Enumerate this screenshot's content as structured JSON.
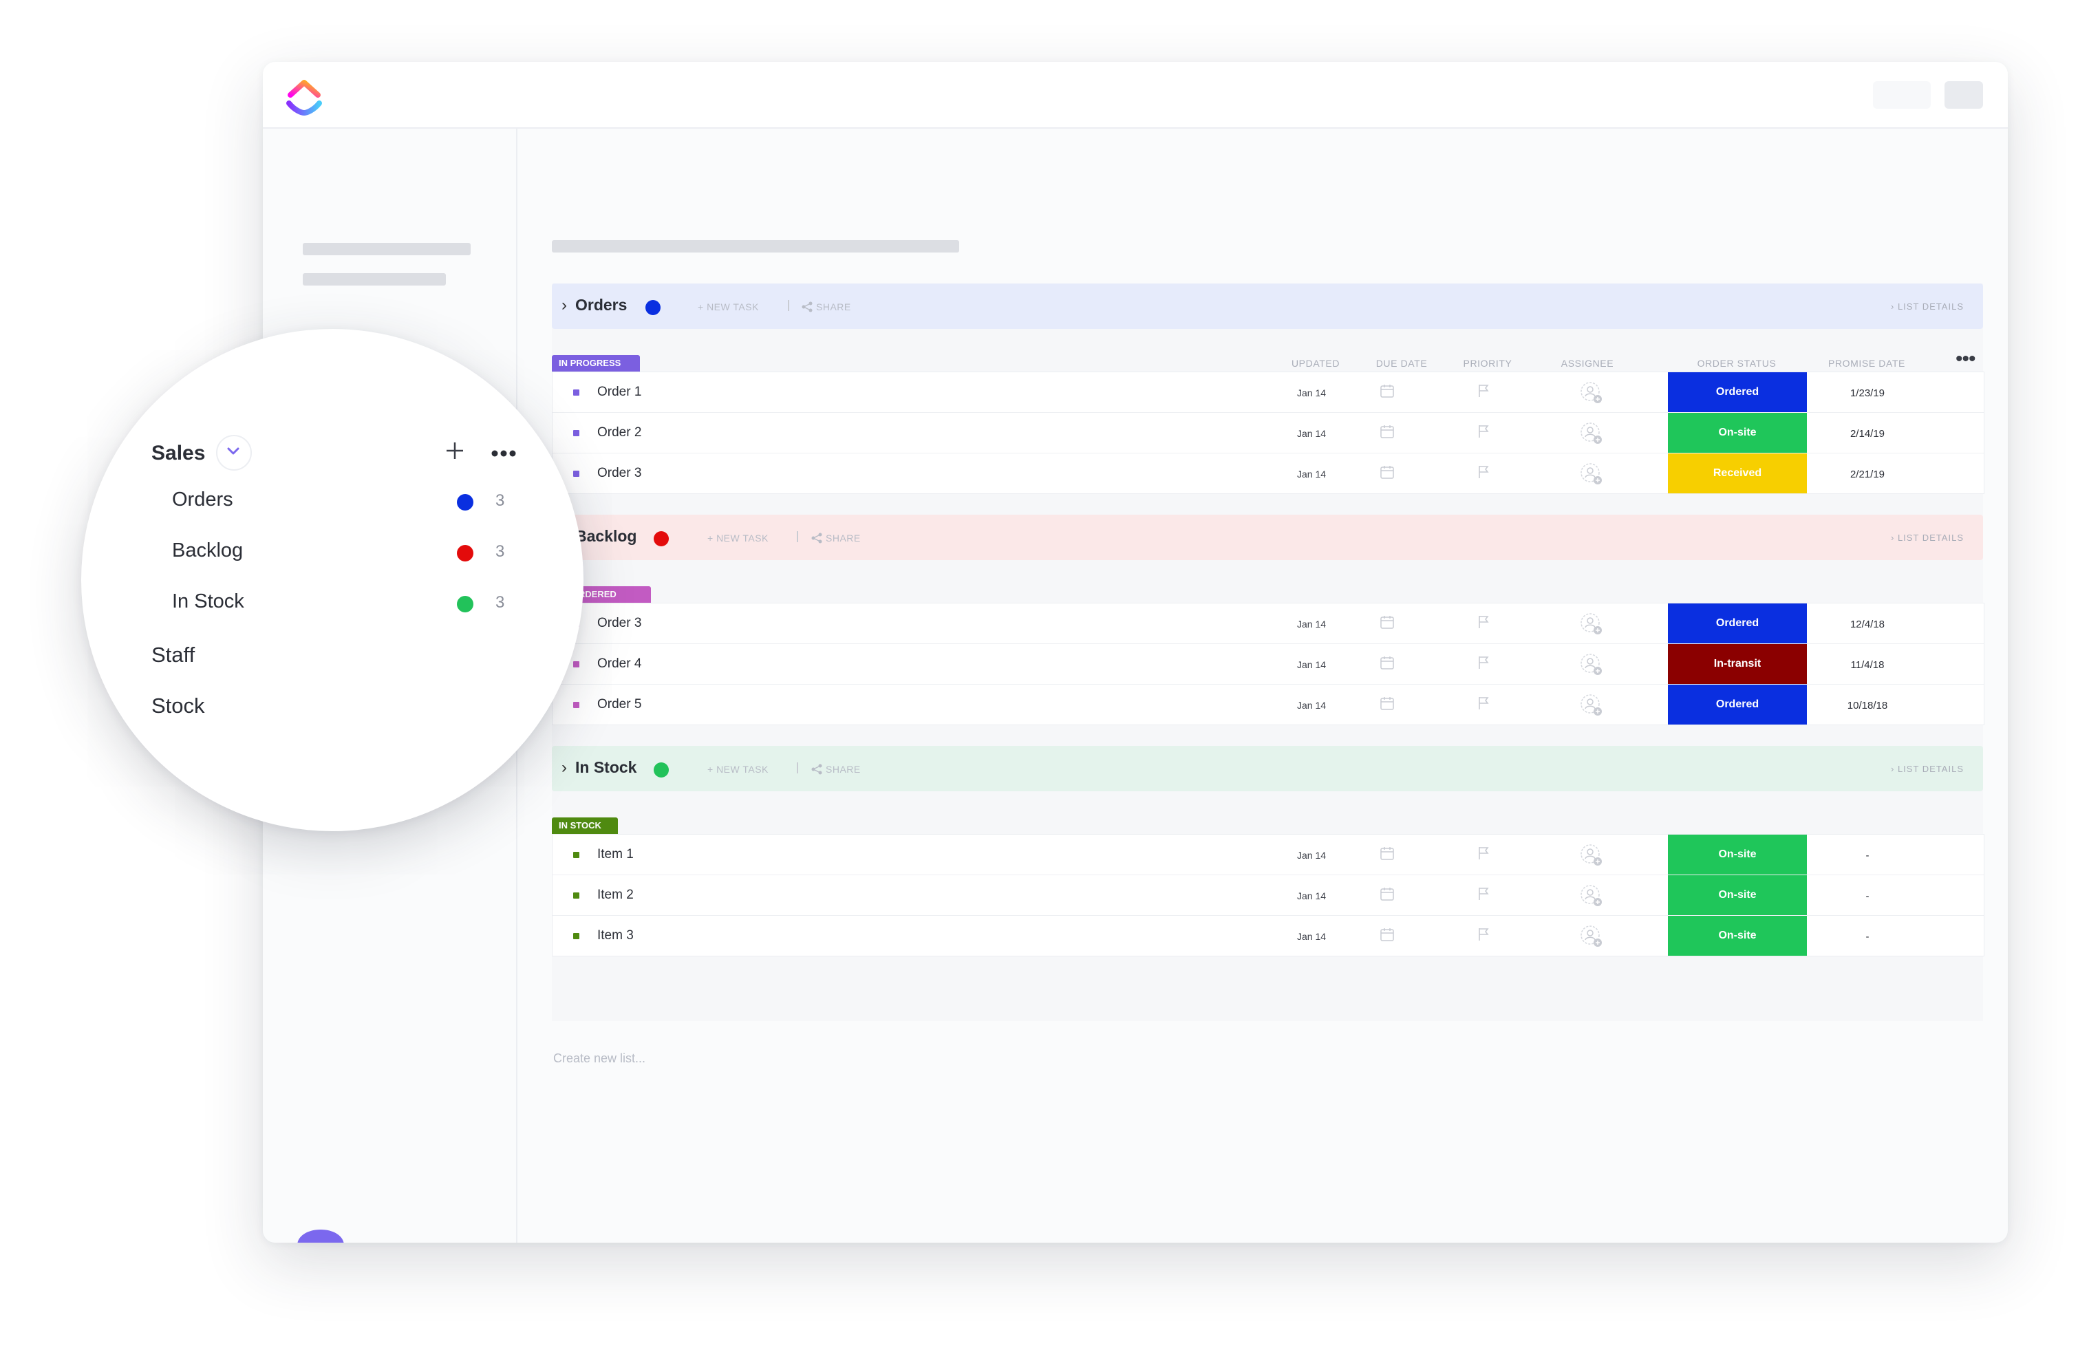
{
  "colors": {
    "orders": "#0a2fe0",
    "backlog": "#e30b0b",
    "in_stock": "#22c25a",
    "accent": "#7b68ee",
    "status_ordered": "#0a2fe0",
    "status_onsite": "#1fc65a",
    "status_received": "#f7cf00",
    "status_intransit": "#8b0000",
    "pill_in_progress": "#7b5fe0",
    "pill_backordered": "#c25bc2",
    "pill_in_stock": "#4f8a10"
  },
  "columns": {
    "updated": "UPDATED",
    "due_date": "DUE DATE",
    "priority": "PRIORITY",
    "assignee": "ASSIGNEE",
    "order_status": "ORDER STATUS",
    "promise_date": "PROMISE DATE",
    "more": "•••"
  },
  "header_actions": {
    "new_task": "+ NEW TASK",
    "separator": "|",
    "share": "SHARE",
    "list_details": "LIST DETAILS"
  },
  "groups": [
    {
      "name": "Orders",
      "pill": "IN PROGRESS",
      "rows": [
        {
          "name": "Order 1",
          "updated": "Jan 14",
          "status": "Ordered",
          "promise": "1/23/19"
        },
        {
          "name": "Order 2",
          "updated": "Jan 14",
          "status": "On-site",
          "promise": "2/14/19"
        },
        {
          "name": "Order 3",
          "updated": "Jan 14",
          "status": "Received",
          "promise": "2/21/19"
        }
      ]
    },
    {
      "name": "Backlog",
      "pill": "CKORDERED",
      "rows": [
        {
          "name": "Order 3",
          "updated": "Jan 14",
          "status": "Ordered",
          "promise": "12/4/18"
        },
        {
          "name": "Order 4",
          "updated": "Jan 14",
          "status": "In-transit",
          "promise": "11/4/18"
        },
        {
          "name": "Order 5",
          "updated": "Jan 14",
          "status": "Ordered",
          "promise": "10/18/18"
        }
      ]
    },
    {
      "name": "In Stock",
      "pill": "IN STOCK",
      "rows": [
        {
          "name": "Item 1",
          "updated": "Jan 14",
          "status": "On-site",
          "promise": "-"
        },
        {
          "name": "Item 2",
          "updated": "Jan 14",
          "status": "On-site",
          "promise": "-"
        },
        {
          "name": "Item 3",
          "updated": "Jan 14",
          "status": "On-site",
          "promise": "-"
        }
      ]
    }
  ],
  "create_list": "Create new list...",
  "sidebar_zoom": {
    "space": "Sales",
    "plus": "+",
    "lists": [
      {
        "name": "Orders",
        "count": "3"
      },
      {
        "name": "Backlog",
        "count": "3"
      },
      {
        "name": "In Stock",
        "count": "3"
      }
    ],
    "folders": [
      "Staff",
      "Stock"
    ]
  },
  "icons": {
    "logo": "clickup-logo",
    "calendar": "calendar-icon",
    "flag": "flag-icon",
    "assignee": "add-assignee-icon",
    "share": "share-icon",
    "chat": "chat-bubble-icon",
    "fab": "notepad-icon"
  }
}
